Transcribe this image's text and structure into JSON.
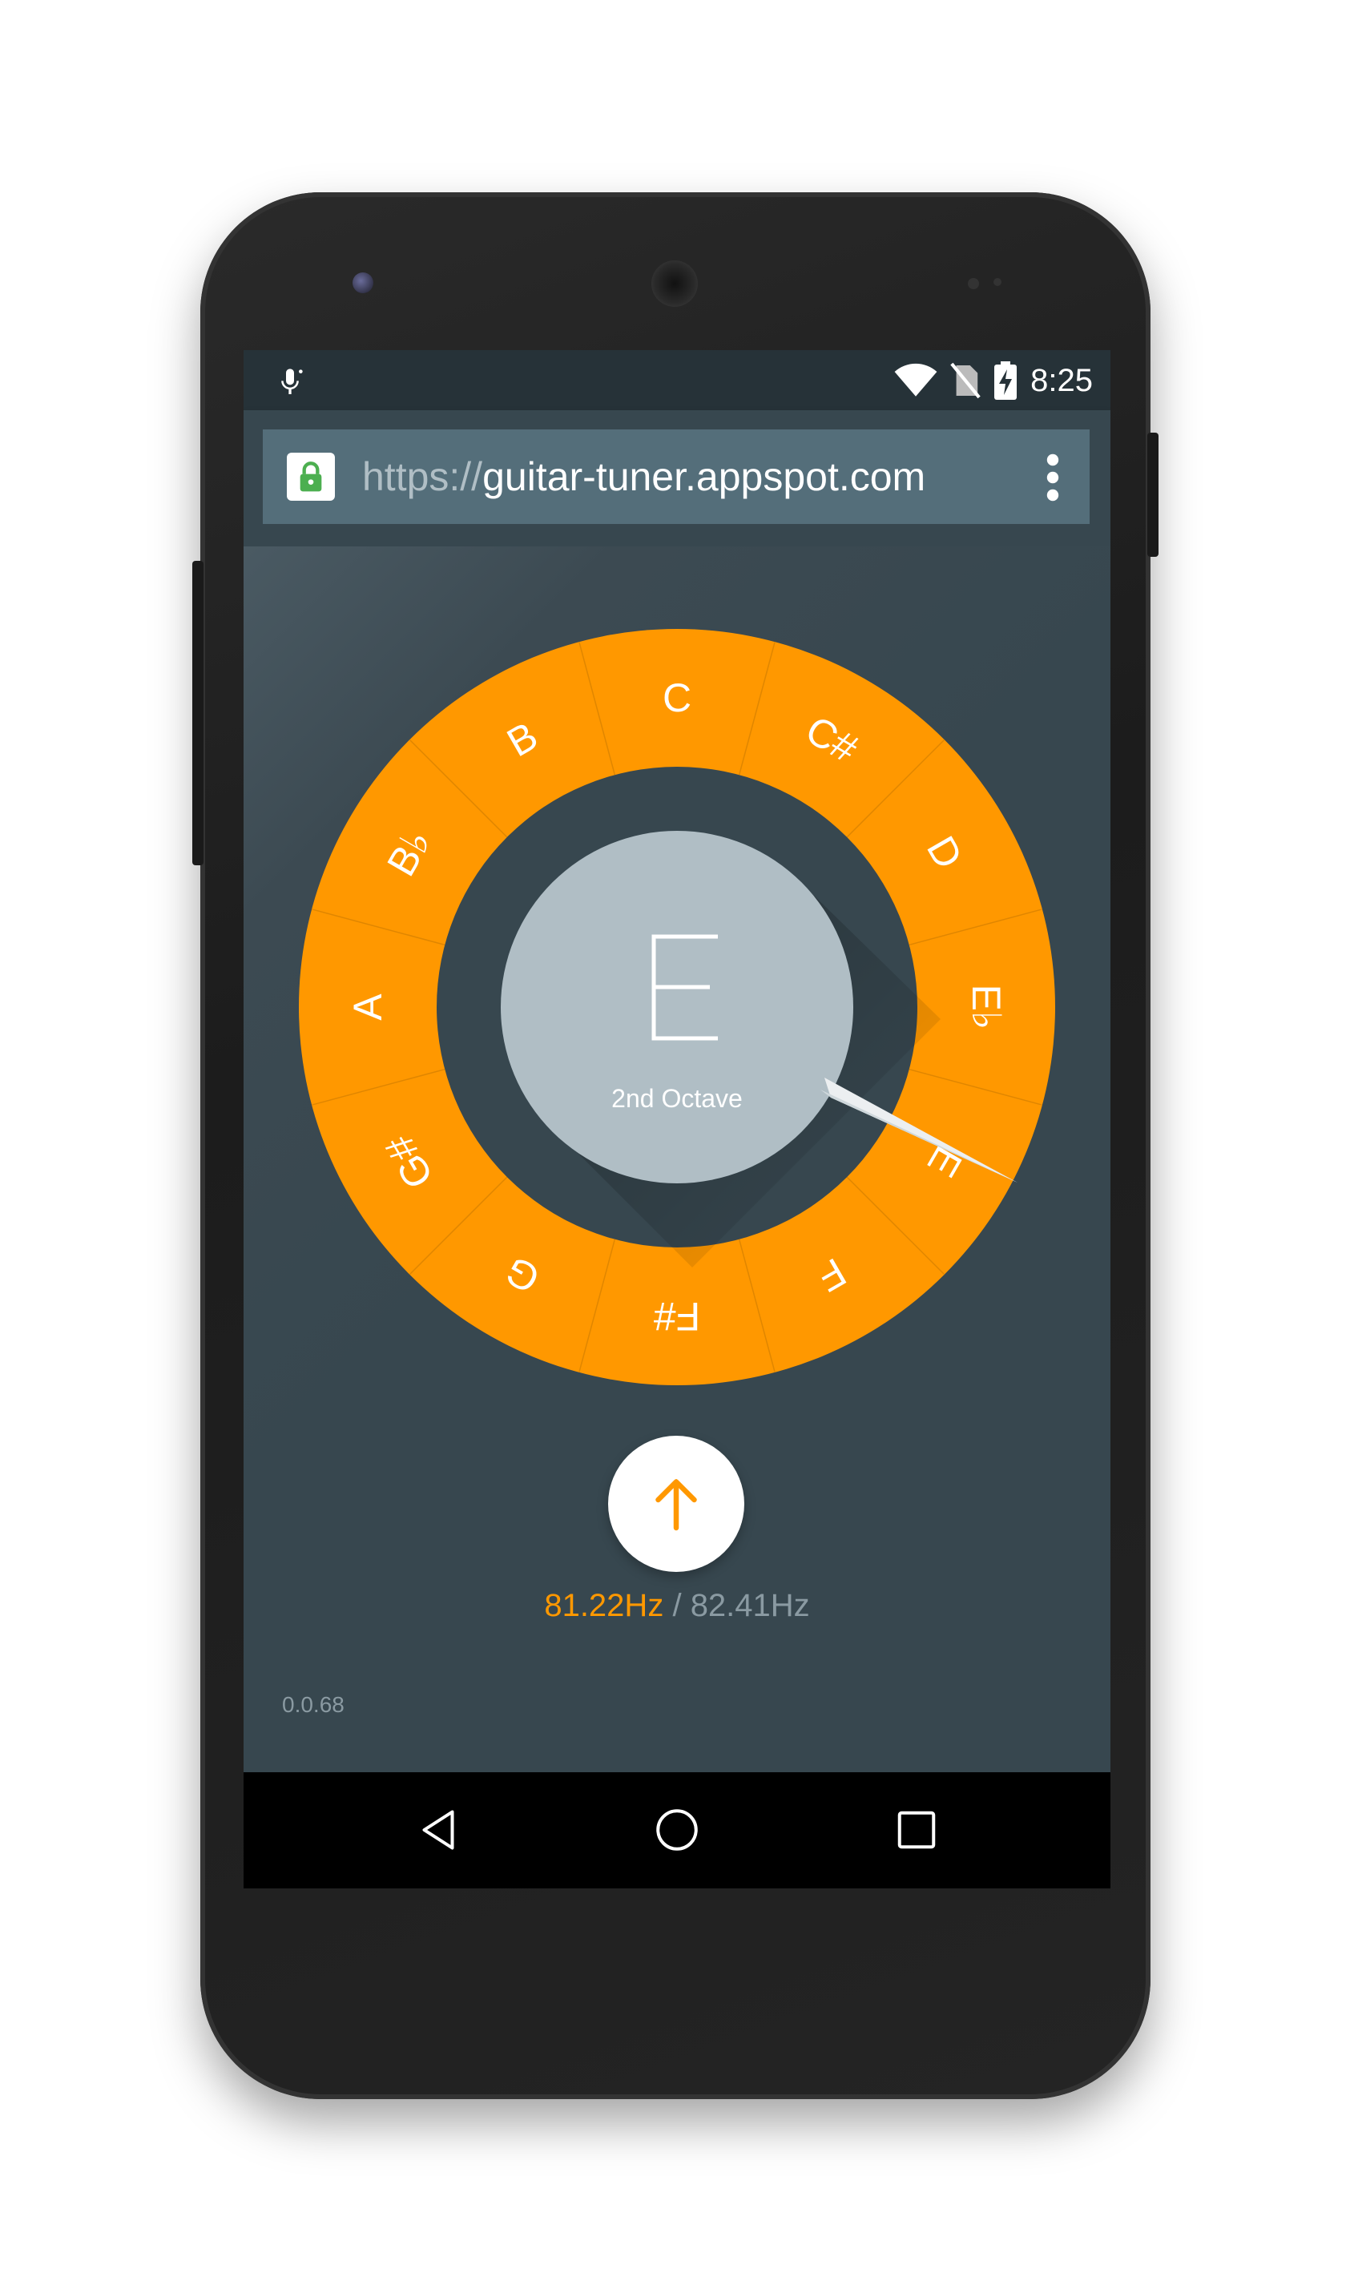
{
  "status_bar": {
    "time": "8:25",
    "icons": [
      "microphone-icon",
      "wifi-icon",
      "no-sim-icon",
      "battery-charging-icon"
    ]
  },
  "browser": {
    "url_scheme": "https://",
    "url_host": "guitar-tuner.appspot.com",
    "lock_icon": "lock-icon",
    "menu_icon": "more-vert-icon"
  },
  "tuner": {
    "notes": [
      "C",
      "C#",
      "D",
      "E♭",
      "E",
      "F",
      "F#",
      "G",
      "G#",
      "A",
      "B♭",
      "B"
    ],
    "current_note": "E",
    "octave": "2nd Octave",
    "direction_icon": "arrow-up-icon",
    "current_freq": "81.22Hz",
    "separator": "/",
    "target_freq": "82.41Hz",
    "version": "0.0.68"
  },
  "colors": {
    "accent": "#ff9800",
    "background": "#37474f",
    "status_bar": "#263238",
    "center_circle": "#b0bec5"
  },
  "nav_bar": {
    "icons": [
      "back-icon",
      "home-icon",
      "recents-icon"
    ]
  }
}
